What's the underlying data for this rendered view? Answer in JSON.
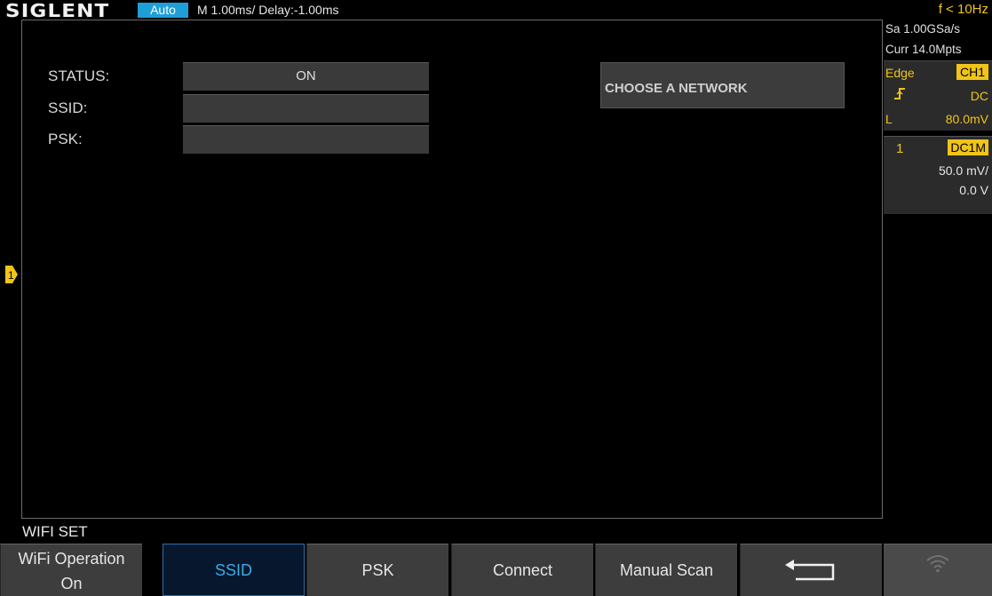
{
  "header": {
    "logo": "SIGLENT",
    "mode": "Auto",
    "timebase": "M 1.00ms/ Delay:-1.00ms",
    "frequency": "f < 10Hz"
  },
  "sidebar": {
    "sample_rate": "Sa 1.00GSa/s",
    "memory_depth": "Curr 14.0Mpts",
    "trigger": {
      "type": "Edge",
      "source": "CH1",
      "coupling": "DC",
      "level_label": "L",
      "level_value": "80.0mV"
    },
    "channel": {
      "number": "1",
      "coupling": "DC1M",
      "scale": "50.0 mV/",
      "offset": "0.0 V"
    }
  },
  "display": {
    "channel_marker": "1",
    "status_label": "STATUS:",
    "status_value": "ON",
    "ssid_label": "SSID:",
    "ssid_value": "",
    "psk_label": "PSK:",
    "psk_value": "",
    "choose_network": "CHOOSE A NETWORK"
  },
  "menu": {
    "title": "WIFI SET",
    "softkeys": [
      {
        "line1": "WiFi Operation",
        "line2": "On"
      },
      {
        "label": "SSID"
      },
      {
        "label": "PSK"
      },
      {
        "label": "Connect"
      },
      {
        "label": "Manual Scan"
      }
    ]
  },
  "colors": {
    "accent_yellow": "#f0c419",
    "mode_blue": "#1f9fd8",
    "active_softkey_text": "#3fa9e6"
  }
}
